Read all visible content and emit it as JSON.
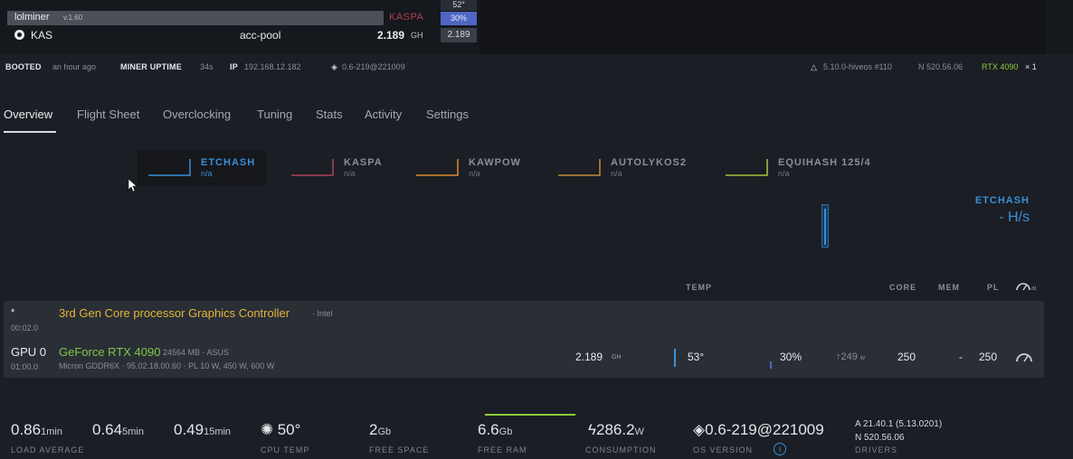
{
  "miner": {
    "name": "lolminer",
    "version": "v.1.60",
    "algo_tag": "KASPA",
    "coin": "KAS",
    "pool": "acc-pool",
    "hashrate": "2.189",
    "hashrate_unit": "GH",
    "temp": "52°",
    "fan": "30%",
    "rate": "2.189"
  },
  "status": {
    "booted_label": "BOOTED",
    "booted_value": "an hour ago",
    "uptime_label": "MINER UPTIME",
    "uptime_value": "34s",
    "ip_label": "IP",
    "ip_value": "192.168.12.182",
    "version": "0.6-219@221009",
    "kernel": "5.10.0-hiveos #110",
    "nvidia_driver": "N 520.56.06",
    "gpu_summary": "RTX 4090",
    "gpu_count": "× 1"
  },
  "tabs": [
    {
      "label": "Overview",
      "active": true
    },
    {
      "label": "Flight Sheet"
    },
    {
      "label": "Overclocking"
    },
    {
      "label": "Tuning"
    },
    {
      "label": "Stats"
    },
    {
      "label": "Activity"
    },
    {
      "label": "Settings"
    }
  ],
  "algos": [
    {
      "name": "ETCHASH",
      "value": "n/a",
      "color": "#3a8fd6"
    },
    {
      "name": "KASPA",
      "value": "n/a",
      "color": "#b0405f"
    },
    {
      "name": "KAWPOW",
      "value": "n/a",
      "color": "#d98a2b"
    },
    {
      "name": "AUTOLYKOS2",
      "value": "n/a",
      "color": "#c48a3a"
    },
    {
      "name": "EQUIHASH 125/4",
      "value": "n/a",
      "color": "#a9c33a"
    }
  ],
  "side_chart": {
    "algo": "ETCHASH",
    "rate": "- H/s"
  },
  "columns": {
    "temp": "TEMP",
    "core": "CORE",
    "mem": "MEM",
    "pl": "PL",
    "ai": "ai"
  },
  "cpu": {
    "star": "*",
    "bus": "00:02.0",
    "name": "3rd Gen Core processor Graphics Controller",
    "vendor": "· Intel"
  },
  "gpu": {
    "index": "GPU 0",
    "bus": "01:00.0",
    "name": "GeForce RTX 4090",
    "memory": "24564 MB · ASUS",
    "details": "Micron GDDR6X · 95.02.18.00.60 · PL 10 W, 450 W, 600 W",
    "hashrate": "2.189",
    "hashrate_unit": "GH",
    "temp": "53°",
    "fan": "30%",
    "power": "↑249",
    "power_unit": "w",
    "core": "250",
    "mem": "-",
    "pl": "250"
  },
  "bottom": {
    "load1": "0.86",
    "load1_u": "1min",
    "load5": "0.64",
    "load5_u": "5min",
    "load15": "0.49",
    "load15_u": "15min",
    "load_label": "LOAD AVERAGE",
    "cpu_temp": "50°",
    "cpu_temp_label": "CPU TEMP",
    "free_space": "2",
    "free_space_u": "Gb",
    "free_space_label": "FREE SPACE",
    "free_ram": "6.6",
    "free_ram_u": "Gb",
    "free_ram_label": "FREE RAM",
    "consumption": "286.2",
    "consumption_u": "W",
    "consumption_label": "CONSUMPTION",
    "os_version": "0.6-219@221009",
    "os_version_label": "OS VERSION",
    "driver_a": "A  21.40.1 (5.13.0201)",
    "driver_n": "N  520.56.06",
    "drivers_label": "DRIVERS"
  },
  "colors": {
    "accent_blue": "#3a8fd6",
    "accent_green": "#8fce3b",
    "cpu_yellow": "#e3b63a",
    "gpu_green": "#7ec94a"
  }
}
